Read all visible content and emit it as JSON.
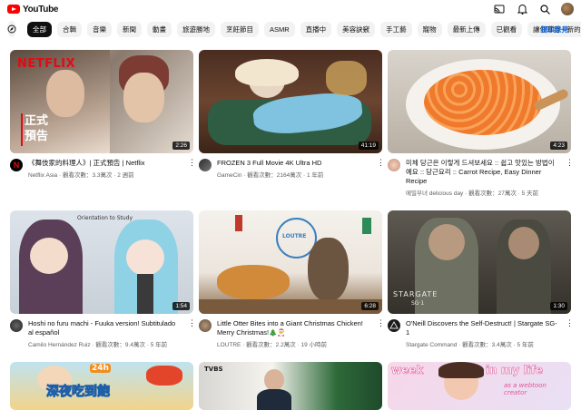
{
  "header": {
    "logo_text": "YouTube"
  },
  "chips": [
    "全部",
    "合輯",
    "音樂",
    "新聞",
    "動畫",
    "旅遊勝地",
    "烹飪節目",
    "ASMR",
    "直播中",
    "美容訣竅",
    "手工藝",
    "寵物",
    "最新上傳",
    "已觀看",
    "讓你耳目一新的影片"
  ],
  "feedback_label": "提供意見",
  "videos": [
    {
      "title": "《舞伎家的料理人》| 正式預告 | Netflix",
      "channel": "Netflix Asia",
      "views": "觀看次數：3.3萬次",
      "age": "2 週前",
      "duration": "2:26",
      "thumb_text1": "NETFLIX",
      "thumb_text2": "正式",
      "thumb_text3": "預告"
    },
    {
      "title": "FROZEN 3 Full Movie 4K Ultra HD",
      "channel": "GameCin",
      "views": "觀看次數：2164萬次",
      "age": "1 年前",
      "duration": "41:19"
    },
    {
      "title": "미체 당근은 이렇게 드셔보세요 :: 쉽고 맛있는 방법이예요 :: 당근요리 :: Carrot Recipe, Easy Dinner Recipe",
      "channel": "메밀부녀 delicious day",
      "views": "觀看次數：27萬次",
      "age": "5 天前",
      "duration": "4:23"
    },
    {
      "title": "Hoshi no furu machi - Fuuka version! Subtitulado al español",
      "channel": "Camilo Hernández Ruiz",
      "views": "觀看次數：9.4萬次",
      "age": "5 年前",
      "duration": "1:54",
      "thumb_text1": "Orientation to Study"
    },
    {
      "title": "Little Otter Bites into a Giant Christmas Chicken!　Merry Christmas!🎄🎅",
      "channel": "LOUTRE",
      "views": "觀看次數：2.2萬次",
      "age": "19 小時前",
      "duration": "6:28",
      "thumb_text1": "LOUTRE"
    },
    {
      "title": "O'Neill Discovers the Self-Destruct! | Stargate SG-1",
      "channel": "Stargate Command",
      "views": "觀看次數：3.4萬次",
      "age": "5 年前",
      "duration": "1:30",
      "thumb_text1": "STARGATE",
      "thumb_text2": "SG·1"
    },
    {
      "title": "",
      "channel": "",
      "views": "",
      "age": "",
      "duration": "",
      "thumb_text1": "深夜吃到飽",
      "thumb_text2": "24h"
    },
    {
      "title": "",
      "channel": "",
      "views": "",
      "age": "",
      "duration": "",
      "thumb_text1": "TVBS"
    },
    {
      "title": "",
      "channel": "",
      "views": "",
      "age": "",
      "duration": "",
      "thumb_text1": "week",
      "thumb_text2": "in my life",
      "thumb_text3": "as a webtoon creator"
    }
  ]
}
